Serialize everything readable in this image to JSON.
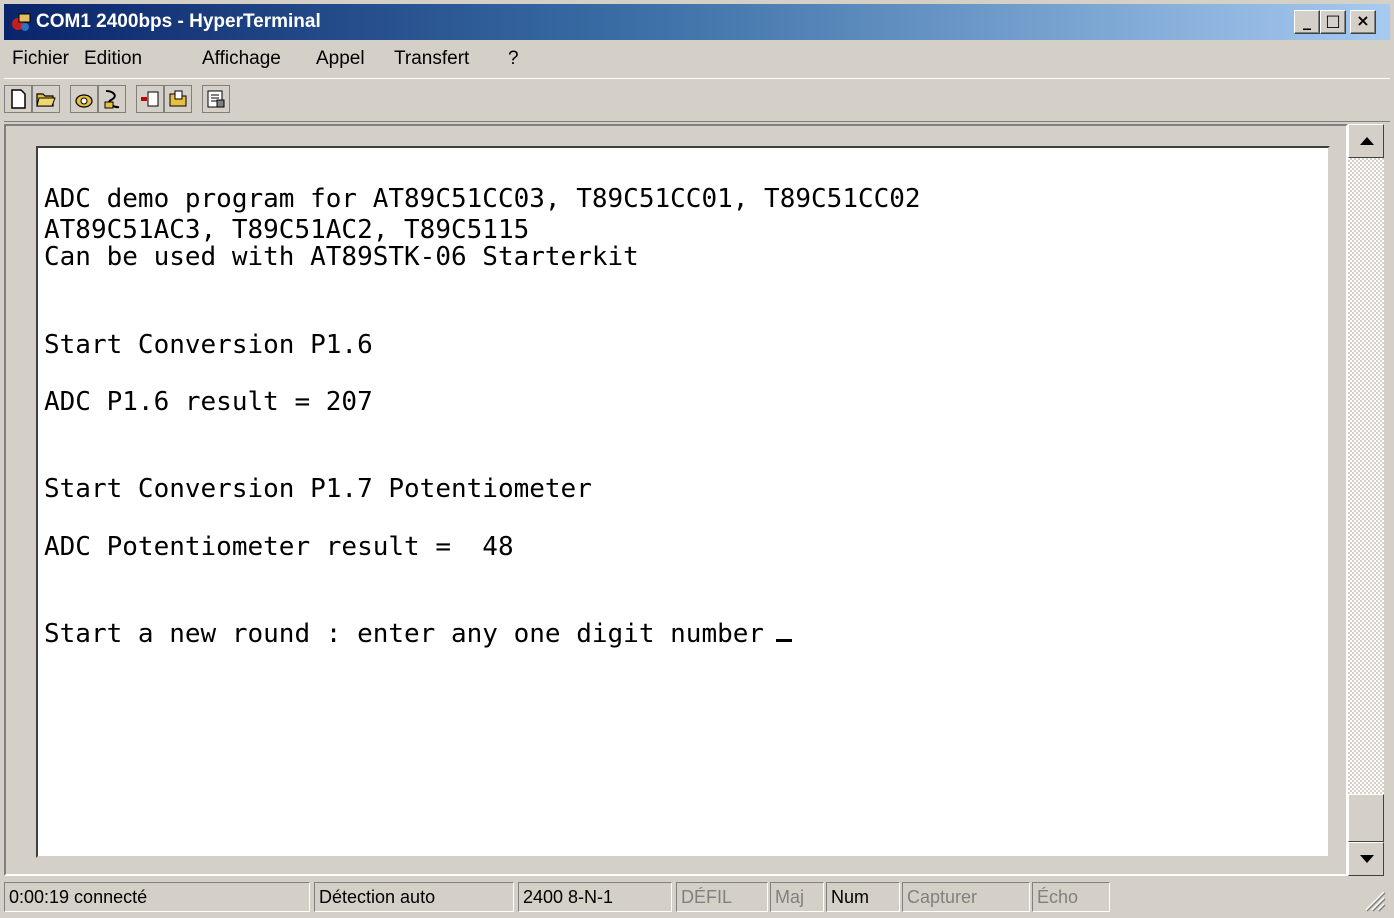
{
  "window": {
    "title": "COM1 2400bps - HyperTerminal",
    "controls": {
      "minimize": "_",
      "maximize": "□",
      "close": "×"
    }
  },
  "menu": [
    {
      "label": "Fichier"
    },
    {
      "label": "Edition"
    },
    {
      "label": "Affichage"
    },
    {
      "label": "Appel"
    },
    {
      "label": "Transfert"
    },
    {
      "label": "?"
    }
  ],
  "toolbar": {
    "buttons": [
      "new-icon",
      "open-icon",
      "call-icon",
      "disconnect-icon",
      "send-icon",
      "receive-icon",
      "properties-icon"
    ]
  },
  "terminal": {
    "lines": [
      "ADC demo program for AT89C51CC03, T89C51CC01, T89C51CC02",
      "AT89C51AC3, T89C51AC2, T89C5115",
      "Can be used with AT89STK-06 Starterkit",
      "Start Conversion P1.6",
      "ADC P1.6 result = 207",
      "Start Conversion P1.7 Potentiometer",
      "ADC Potentiometer result =  48",
      "Start a new round : enter any one digit number"
    ]
  },
  "status": {
    "elapsed": "0:00:19 connecté",
    "detection": "Détection auto",
    "settings": "2400 8-N-1",
    "scroll": "DÉFIL",
    "caps": "Maj",
    "num": "Num",
    "capture": "Capturer",
    "echo": "Écho"
  }
}
